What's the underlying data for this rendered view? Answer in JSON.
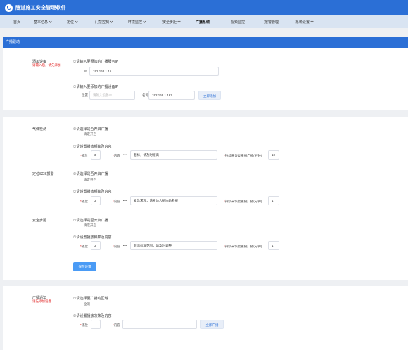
{
  "app": {
    "title": "隧道施工安全管理软件"
  },
  "nav": {
    "items": [
      {
        "label": "首页",
        "has_dropdown": false,
        "active": false
      },
      {
        "label": "基本信息",
        "has_dropdown": true,
        "active": false
      },
      {
        "label": "定位",
        "has_dropdown": true,
        "active": false
      },
      {
        "label": "门禁控制",
        "has_dropdown": true,
        "active": false
      },
      {
        "label": "环境监控",
        "has_dropdown": true,
        "active": false
      },
      {
        "label": "安全步距",
        "has_dropdown": true,
        "active": false
      },
      {
        "label": "广播系统",
        "has_dropdown": false,
        "active": true
      },
      {
        "label": "视频监控",
        "has_dropdown": false,
        "active": false
      },
      {
        "label": "报警管理",
        "has_dropdown": false,
        "active": false
      },
      {
        "label": "系统设置",
        "has_dropdown": true,
        "active": false
      }
    ]
  },
  "panel": {
    "header": "广播联动"
  },
  "add_device": {
    "label": "添加设备",
    "hint": "请输入后，请先添加",
    "server_question": "①请输入要添加的广播服务IP",
    "server_ip_label": "IP",
    "server_ip_value": "192.168.1.16",
    "device_question": "①请输入要添加的广播设备IP",
    "location_label": "位置",
    "location_placeholder": "请输入设备IP",
    "device_ip_label": "名称",
    "device_ip_value": "192.168.1.167",
    "add_button": "立即添加"
  },
  "sections": [
    {
      "label": "气体检测",
      "q_enable": "①请选择是否开启广播",
      "enable_value": "确定开启",
      "q_settings": "①请设置播放频率及内容",
      "times_label": "播放",
      "times_value": "3",
      "content_label": "内容",
      "content_value": "超标，请及时撤离",
      "duration_label": "持续未恢复重播广播(分钟)",
      "duration_value": "10"
    },
    {
      "label": "定位SOS报警",
      "q_enable": "①请选择是否开启广播",
      "enable_value": "确定开启",
      "q_settings": "①请设置播放频率及内容",
      "times_label": "播放",
      "times_value": "3",
      "content_label": "内容",
      "content_value": "紧急求救，请身边人员协助救援",
      "duration_label": "持续未恢复重播广播(分钟)",
      "duration_value": "1"
    },
    {
      "label": "安全步距",
      "q_enable": "①请选择是否开启广播",
      "enable_value": "确定开启",
      "q_settings": "①请设置播放频率及内容",
      "times_label": "播放",
      "times_value": "3",
      "content_label": "内容",
      "content_value": "超出标准范围，请及时调整",
      "duration_label": "持续未恢复重播广播(分钟)",
      "duration_value": "1"
    }
  ],
  "save_button": "保存设置",
  "broadcast": {
    "label": "广播通知",
    "hint": "请先添加设备",
    "q_area": "①请选择要广播的区域",
    "area_value": "全洞",
    "q_settings": "①请设置播放次数及内容",
    "times_label": "播放",
    "content_label": "内容",
    "broadcast_button": "立即广播"
  },
  "colors": {
    "brand": "#2b6fd6",
    "nav_bg": "#d9e4f2",
    "primary_button": "#4a9bf5",
    "hint_red": "#e02020"
  }
}
